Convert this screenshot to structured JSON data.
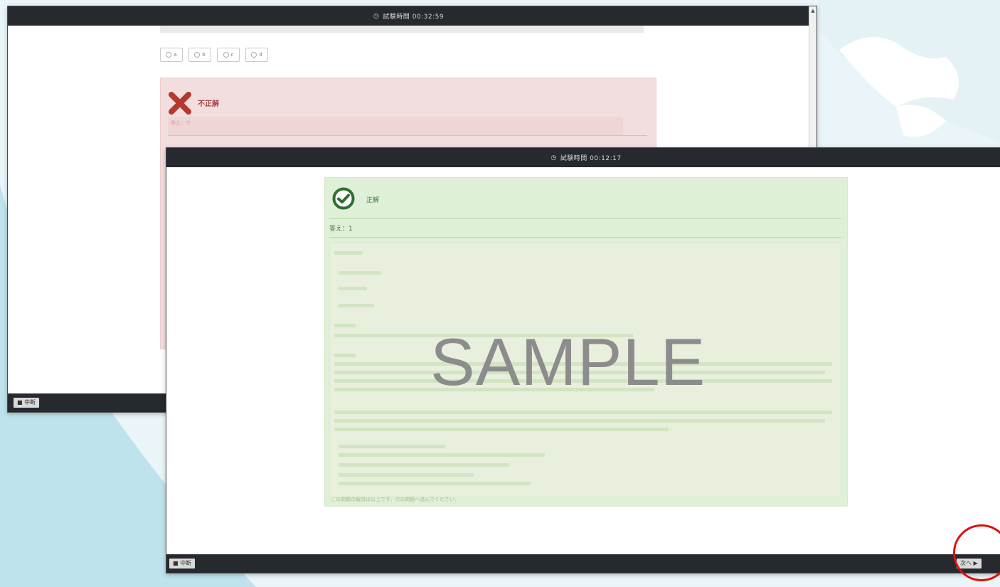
{
  "back_window": {
    "title": "試験時間 00:32:59",
    "clock_icon": "clock-icon",
    "choices": [
      "a",
      "b",
      "c",
      "d"
    ],
    "result_label": "不正解",
    "result_sub": "答え：ウ",
    "footer_button": "■ 中断",
    "status_color": "#a94442"
  },
  "front_window": {
    "title": "試験時間 00:12:17",
    "clock_icon": "clock-icon",
    "result_label": "正解",
    "answer_line": "答え：1",
    "bottom_note": "この問題の解説は以上です。次の問題へ進んでください。",
    "footer_left_button": "■ 中断",
    "footer_right_button": "次へ ▶",
    "status_color": "#3c763d"
  },
  "watermark": "SAMPLE",
  "highlight_color": "#e10d0d"
}
